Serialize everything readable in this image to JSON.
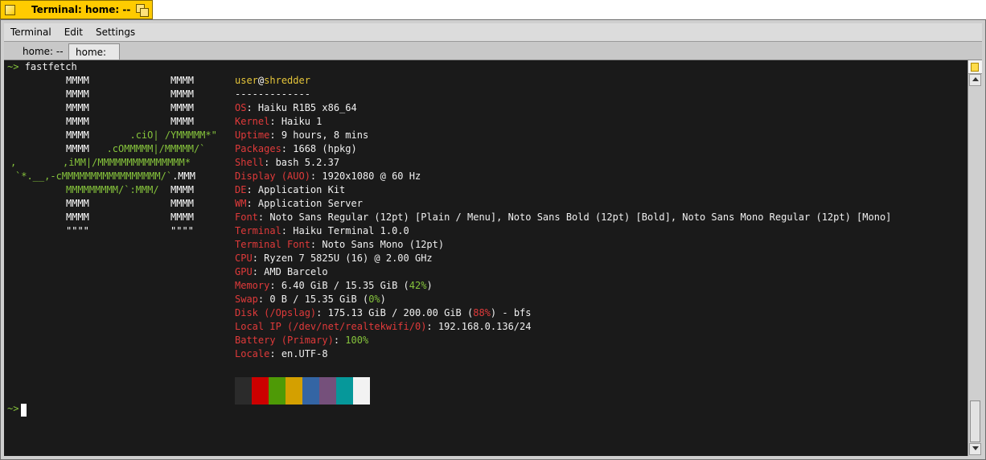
{
  "window": {
    "title": "Terminal: home: --"
  },
  "menubar": {
    "items": [
      "Terminal",
      "Edit",
      "Settings"
    ]
  },
  "tabs": [
    "home: --",
    "home: --"
  ],
  "prompt": "~>",
  "command": "fastfetch",
  "logo": [
    [
      "",
      "MMMM              MMMM"
    ],
    [
      "",
      "MMMM              MMMM"
    ],
    [
      "",
      "MMMM              MMMM"
    ],
    [
      "",
      "MMMM              MMMM"
    ],
    [
      "",
      "MMMM       .ciO| /YMMMMM*\""
    ],
    [
      "",
      "MMMM   .cOMMMMM|/MMMMM/`"
    ],
    [
      ",",
      "        ,iMM|/MMMMMMMMMMMMMMM*"
    ],
    [
      "",
      "`*.__,-cMMMMMMMMMMMMMMMMM/`.MMM"
    ],
    [
      "",
      "MMMMMMMMM/`:MMM/  MMMM"
    ],
    [
      "",
      "MMMM              MMMM"
    ],
    [
      "",
      "MMMM              MMMM"
    ],
    [
      "",
      "\"\"\"\"              \"\"\"\""
    ]
  ],
  "info": {
    "user": "user",
    "at": "@",
    "host": "shredder",
    "separator": "-------------",
    "rows": [
      {
        "key": "OS",
        "value": "Haiku R1B5 x86_64"
      },
      {
        "key": "Kernel",
        "value": "Haiku 1"
      },
      {
        "key": "Uptime",
        "value": "9 hours, 8 mins"
      },
      {
        "key": "Packages",
        "value": "1668 (hpkg)"
      },
      {
        "key": "Shell",
        "value": "bash 5.2.37"
      },
      {
        "key": "Display (AUO)",
        "value": "1920x1080 @ 60 Hz"
      },
      {
        "key": "DE",
        "value": "Application Kit"
      },
      {
        "key": "WM",
        "value": "Application Server"
      },
      {
        "key": "Font",
        "value": "Noto Sans Regular (12pt) [Plain / Menu], Noto Sans Bold (12pt) [Bold], Noto Sans Mono Regular (12pt) [Mono]"
      },
      {
        "key": "Terminal",
        "value": "Haiku Terminal 1.0.0"
      },
      {
        "key": "Terminal Font",
        "value": "Noto Sans Mono (12pt)"
      },
      {
        "key": "CPU",
        "value": "Ryzen 7 5825U (16) @ 2.00 GHz"
      },
      {
        "key": "GPU",
        "value": "AMD Barcelo"
      },
      {
        "key": "Memory",
        "value": "6.40 GiB / 15.35 GiB (",
        "pct": "42%",
        "pct_color": "#86c43c",
        "tail": ")"
      },
      {
        "key": "Swap",
        "value": "0 B / 15.35 GiB (",
        "pct": "0%",
        "pct_color": "#86c43c",
        "tail": ")"
      },
      {
        "key": "Disk (/Opslag)",
        "value": "175.13 GiB / 200.00 GiB (",
        "pct": "88%",
        "pct_color": "#e03a3a",
        "tail": ") - bfs"
      },
      {
        "key": "Local IP (/dev/net/realtekwifi/0)",
        "value": "192.168.0.136/24"
      },
      {
        "key": "Battery (Primary)",
        "value": "",
        "pct": "100%",
        "pct_color": "#86c43c",
        "tail": ""
      },
      {
        "key": "Locale",
        "value": "en.UTF-8"
      }
    ]
  },
  "palette": [
    "#2b2b2b",
    "#cc0000",
    "#4e9a06",
    "#d4a000",
    "#3465a4",
    "#75507b",
    "#06989a",
    "#f2f2f2"
  ],
  "colors": {
    "key": "#e03a3a",
    "user": "#e5c53a",
    "logo_green": "#86c43c",
    "tab": "#ffcb00"
  }
}
